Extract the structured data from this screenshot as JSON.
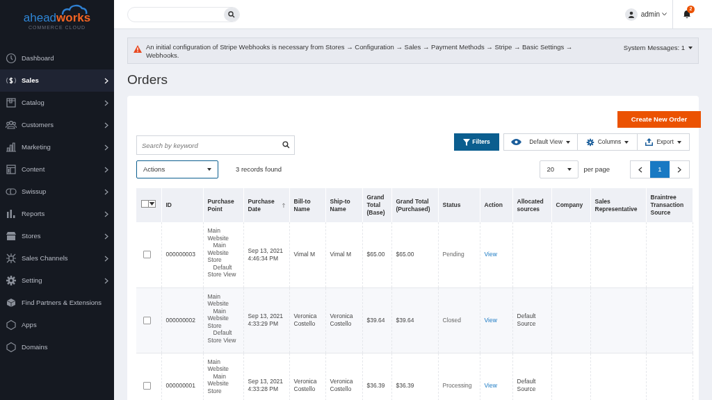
{
  "logo": {
    "part1": "ahead",
    "part2": "works",
    "tagline": "COMMERCE CLOUD"
  },
  "sidebar": {
    "items": [
      {
        "label": "Dashboard",
        "selected": false,
        "has_children": false
      },
      {
        "label": "Sales",
        "selected": true,
        "has_children": true
      },
      {
        "label": "Catalog",
        "selected": false,
        "has_children": true
      },
      {
        "label": "Customers",
        "selected": false,
        "has_children": true
      },
      {
        "label": "Marketing",
        "selected": false,
        "has_children": true
      },
      {
        "label": "Content",
        "selected": false,
        "has_children": true
      },
      {
        "label": "Swissup",
        "selected": false,
        "has_children": true
      },
      {
        "label": "Reports",
        "selected": false,
        "has_children": true
      },
      {
        "label": "Stores",
        "selected": false,
        "has_children": true
      },
      {
        "label": "Sales Channels",
        "selected": false,
        "has_children": true
      },
      {
        "label": "Setting",
        "selected": false,
        "has_children": true
      },
      {
        "label": "Find Partners & Extensions",
        "selected": false,
        "has_children": false
      },
      {
        "label": "Apps",
        "selected": false,
        "has_children": false
      },
      {
        "label": "Domains",
        "selected": false,
        "has_children": false
      }
    ]
  },
  "header": {
    "user": "admin",
    "notifications": "2"
  },
  "message": {
    "text": "An initial configuration of Stripe Webhooks is necessary from Stores → Configuration → Sales → Payment Methods → Stripe → Basic Settings → Webhooks.",
    "system_messages": "System Messages: 1"
  },
  "page_title": "Orders",
  "create_button": "Create New Order",
  "search": {
    "placeholder": "Search by keyword"
  },
  "toolbar": {
    "filters": "Filters",
    "view": "Default View",
    "columns": "Columns",
    "export": "Export"
  },
  "actions": "Actions",
  "records_found": "3 records found",
  "per_page": {
    "value": "20",
    "label": "per page"
  },
  "pagination": {
    "page": "1"
  },
  "table": {
    "columns": [
      {
        "label": "ID",
        "sorted": false
      },
      {
        "label": "Purchase Point",
        "sorted": false
      },
      {
        "label": "Purchase Date",
        "sorted": true
      },
      {
        "label": "Bill-to Name",
        "sorted": false
      },
      {
        "label": "Ship-to Name",
        "sorted": false
      },
      {
        "label": "Grand Total (Base)",
        "sorted": false
      },
      {
        "label": "Grand Total (Purchased)",
        "sorted": false
      },
      {
        "label": "Status",
        "sorted": false
      },
      {
        "label": "Action",
        "sorted": false
      },
      {
        "label": "Allocated sources",
        "sorted": false
      },
      {
        "label": "Company",
        "sorted": false
      },
      {
        "label": "Sales Representative",
        "sorted": false
      },
      {
        "label": "Braintree Transaction Source",
        "sorted": false
      }
    ],
    "mass_select": {
      "checked": false
    },
    "rows": [
      {
        "checked": false,
        "id": "000000003",
        "purchase_point": [
          "Main Website",
          "Main Website Store",
          "Default Store View"
        ],
        "purchase_date": "Sep 13, 2021 4:46:34 PM",
        "bill_to": "Vimal M",
        "ship_to": "Vimal M",
        "grand_total_base": "$65.00",
        "grand_total_purchased": "$65.00",
        "status": "Pending",
        "action": "View"
      },
      {
        "checked": false,
        "id": "000000002",
        "purchase_point": [
          "Main Website",
          "Main Website Store",
          "Default Store View"
        ],
        "purchase_date": "Sep 13, 2021 4:33:29 PM",
        "bill_to": "Veronica Costello",
        "ship_to": "Veronica Costello",
        "grand_total_base": "$39.64",
        "grand_total_purchased": "$39.64",
        "status": "Closed",
        "action": "View",
        "allocated_sources": "Default Source"
      },
      {
        "checked": false,
        "id": "000000001",
        "purchase_point": [
          "Main Website",
          "Main Website Store"
        ],
        "purchase_date": "Sep 13, 2021 4:33:28 PM",
        "bill_to": "Veronica Costello",
        "ship_to": "Veronica Costello",
        "grand_total_base": "$36.39",
        "grand_total_purchased": "$36.39",
        "status": "Processing",
        "action": "View",
        "allocated_sources": "Default Source"
      }
    ]
  }
}
